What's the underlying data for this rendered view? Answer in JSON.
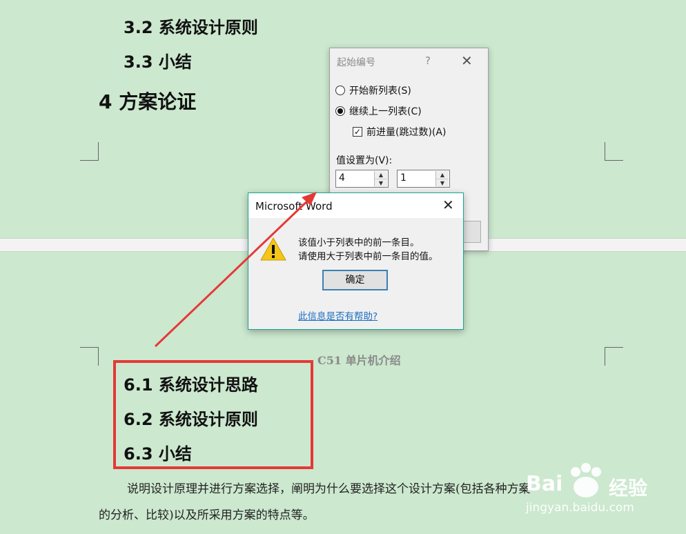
{
  "document": {
    "top_headings": [
      {
        "text": "3.2 系统设计原则"
      },
      {
        "text": "3.3 小结"
      },
      {
        "text": "4  方案论证"
      }
    ],
    "page_header": "C51 单片机介绍",
    "highlighted_headings": [
      {
        "text": "6.1 系统设计思路"
      },
      {
        "text": "6.2 系统设计原则"
      },
      {
        "text": "6.3 小结"
      }
    ],
    "body_line1": "说明设计原理并进行方案选择，阐明为什么要选择这个设计方案(包括各种方案",
    "body_line2": "的分析、比较)以及所采用方案的特点等。"
  },
  "start_dialog": {
    "title": "起始编号",
    "help": "?",
    "close": "✕",
    "radio_new": "开始新列表(S)",
    "radio_continue": "继续上一列表(C)",
    "checkbox_advance": "前进量(跳过数)(A)",
    "value_label": "值设置为(V):",
    "value_1": "4",
    "value_2": "1"
  },
  "alert_dialog": {
    "title": "Microsoft Word",
    "close": "✕",
    "message_1": "该值小于列表中的前一条目。",
    "message_2": "请使用大于列表中前一条目的值。",
    "ok_label": "确定",
    "help_link": "此信息是否有帮助?"
  },
  "watermark": {
    "brand": "Bai",
    "brand_cn": "经验",
    "url": "jingyan.baidu.com"
  },
  "colors": {
    "page_bg": "#cce8cf",
    "highlight": "#e53935",
    "arrow": "#e53935",
    "link": "#1a6fc2"
  }
}
